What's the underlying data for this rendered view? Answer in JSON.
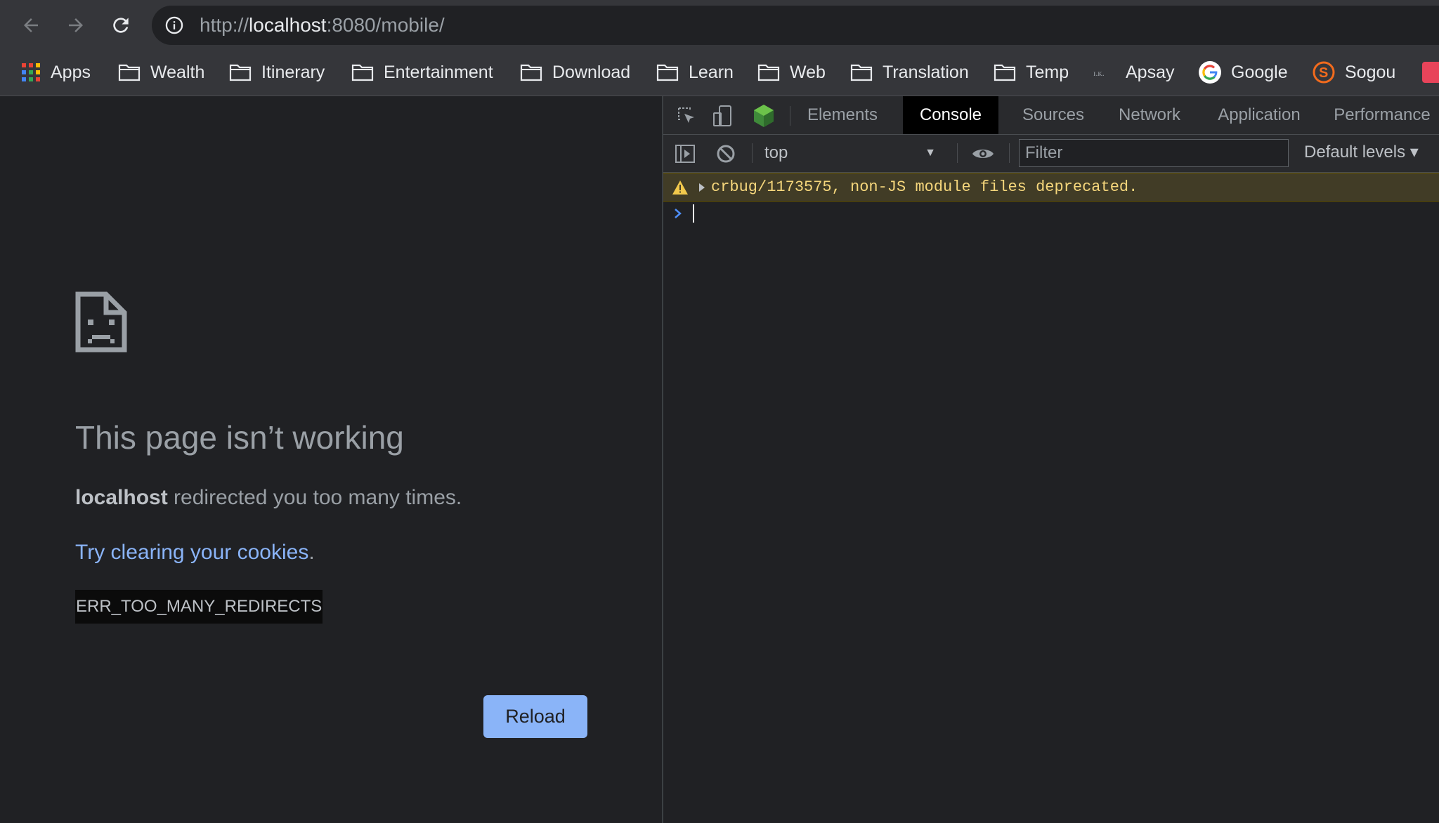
{
  "browser": {
    "url_prefix": "http://",
    "url_host": "localhost",
    "url_rest": ":8080/mobile/",
    "bookmarks": [
      {
        "label": "Apps",
        "icon": "apps-grid-icon"
      },
      {
        "label": "Wealth",
        "icon": "folder-icon"
      },
      {
        "label": "Itinerary",
        "icon": "folder-icon"
      },
      {
        "label": "Entertainment",
        "icon": "folder-icon"
      },
      {
        "label": "Download",
        "icon": "folder-icon"
      },
      {
        "label": "Learn",
        "icon": "folder-icon"
      },
      {
        "label": "Web",
        "icon": "folder-icon"
      },
      {
        "label": "Translation",
        "icon": "folder-icon"
      },
      {
        "label": "Temp",
        "icon": "folder-icon"
      },
      {
        "label": "Apsay",
        "icon": "apsay-icon"
      },
      {
        "label": "Google",
        "icon": "google-icon"
      },
      {
        "label": "Sogou",
        "icon": "sogou-icon"
      }
    ]
  },
  "error_page": {
    "title": "This page isn’t working",
    "host": "localhost",
    "message": " redirected you too many times.",
    "link": "Try clearing your cookies",
    "link_suffix": ".",
    "code": "ERR_TOO_MANY_REDIRECTS",
    "reload_label": "Reload"
  },
  "devtools": {
    "tabs": [
      "Elements",
      "Console",
      "Sources",
      "Network",
      "Application",
      "Performance"
    ],
    "active_tab": "Console",
    "context": "top",
    "filter_placeholder": "Filter",
    "levels_label": "Default levels ▾",
    "warning_message": "crbug/1173575, non-JS module files deprecated."
  },
  "colors": {
    "accent": "#8ab4f8",
    "warning_bg": "#413c26",
    "warning_text": "#f6d77c"
  }
}
